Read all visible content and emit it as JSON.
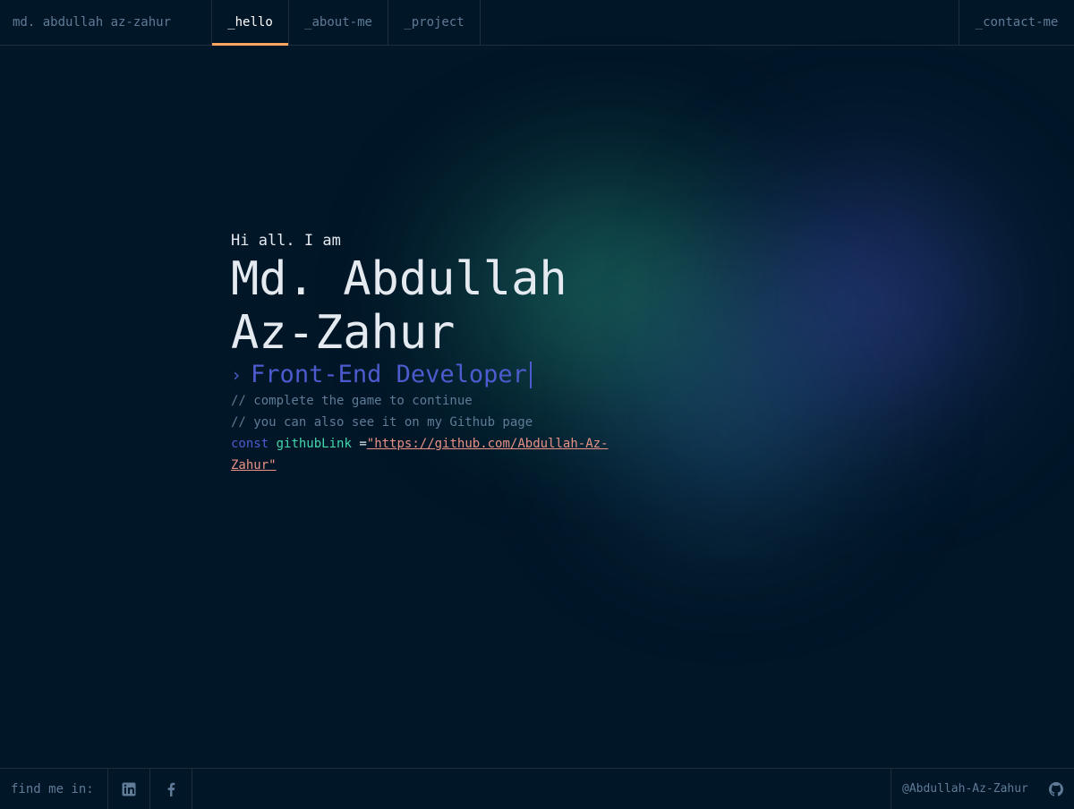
{
  "header": {
    "brand": "md. abdullah az-zahur",
    "tabs": [
      {
        "label": "_hello",
        "active": true
      },
      {
        "label": "_about-me",
        "active": false
      },
      {
        "label": "_project",
        "active": false
      }
    ],
    "contact_label": "_contact-me"
  },
  "hero": {
    "greeting": "Hi all. I am",
    "name_line1": "Md. Abdullah",
    "name_line2": "Az-Zahur",
    "role_chevron": "›",
    "role": "Front-End Developer",
    "comment1": "// complete the game to continue",
    "comment2": "// you can also see it on my Github page",
    "code_keyword": "const",
    "code_var": "githubLink",
    "code_eq": "=",
    "code_string": "\"https://github.com/Abdullah-Az-Zahur\""
  },
  "footer": {
    "find_label": "find me in:",
    "socials": [
      {
        "icon": "linkedin-icon"
      },
      {
        "icon": "facebook-icon"
      }
    ],
    "github_handle": "@Abdullah-Az-Zahur"
  },
  "colors": {
    "background": "#011627",
    "border": "#1e2d3d",
    "muted": "#607b96",
    "accent_orange": "#fea55f",
    "accent_blue": "#4d5bce",
    "accent_green": "#43d9ad",
    "string": "#e99287",
    "text_light": "#e5e9f0"
  }
}
